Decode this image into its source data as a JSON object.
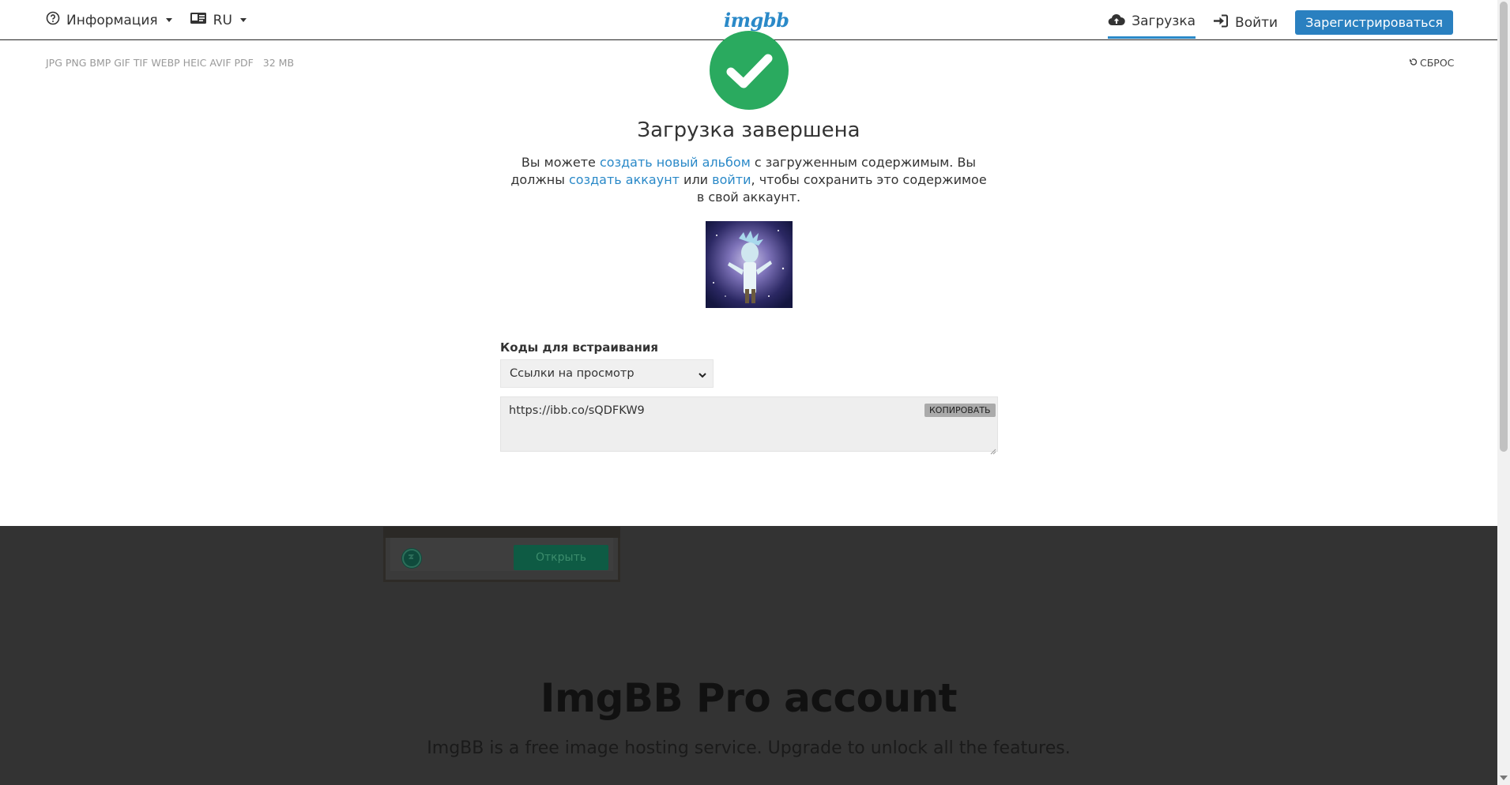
{
  "header": {
    "info_label": "Информация",
    "lang_label": "RU",
    "logo_text": "imgbb",
    "upload_label": "Загрузка",
    "login_label": "Войти",
    "signup_label": "Зарегистрироваться"
  },
  "upload_panel": {
    "formats": "JPG PNG BMP GIF TIF WEBP HEIC AVIF PDF",
    "max_size": "32 MB",
    "reset_label": "СБРОС",
    "title": "Загрузка завершена",
    "message": {
      "part1": "Вы можете ",
      "link_album": "создать новый альбом",
      "part2": " с загруженным содержимым. Вы должны ",
      "link_account": "создать аккаунт",
      "part3": " или ",
      "link_login": "войти",
      "part4": ", чтобы сохранить это содержимое в свой аккаунт."
    },
    "embed_label": "Коды для встраивания",
    "embed_select_value": "Ссылки на просмотр",
    "embed_code": "https://ibb.co/sQDFKW9",
    "copy_label": "КОПИРОВАТЬ"
  },
  "ad": {
    "button_label": "Открыть"
  },
  "pro": {
    "title": "ImgBB Pro account",
    "subtitle": "ImgBB is a free image hosting service. Upgrade to unlock all the features."
  },
  "colors": {
    "accent": "#2a89c8",
    "success": "#2aaa5f",
    "overlay": "#333333"
  }
}
